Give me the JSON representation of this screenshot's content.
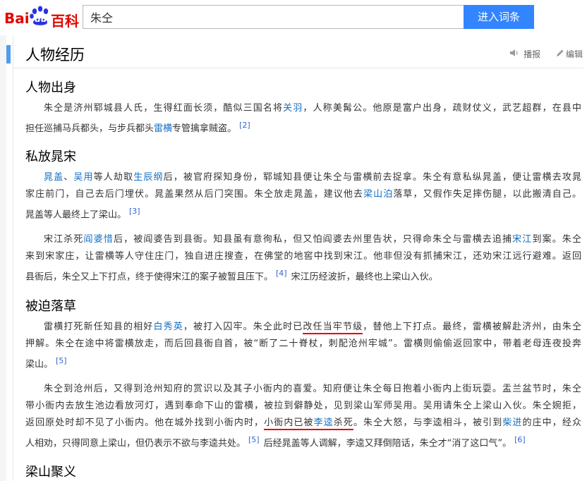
{
  "header": {
    "logo_bai": "Bai",
    "logo_du": "du",
    "logo_baike": "百科",
    "search_value": "朱仝",
    "search_button": "进入词条"
  },
  "section": {
    "title": "人物经历",
    "play_label": "播报",
    "edit_label": "编辑"
  },
  "subsections": [
    {
      "title": "人物出身"
    },
    {
      "title": "私放晁宋"
    },
    {
      "title": "被迫落草"
    },
    {
      "title": "梁山聚义"
    }
  ],
  "text": {
    "p1l1a": "朱仝是济州郓城县人氏，生得红面长须，酷似三国名将",
    "p1l1link": "关羽",
    "p1l1b": "，人称美髯公。他原是富户出身，疏财仗义，武艺超群，在县中",
    "p1l2a": "担任",
    "p1l2ul": "巡捕马兵都头，与步兵都头",
    "p1l2link": "雷横",
    "p1l2ul2": "专管擒拿贼盗",
    "p1l2b": "。",
    "p1sup": "[2]",
    "p2l1link1": "晁盖",
    "p2l1sep": "、",
    "p2l1link2": "吴用",
    "p2l1a": "等人劫取",
    "p2l1link3": "生辰纲",
    "p2l1b": "后，被官府探知身份，郓城知县便让朱仝与雷横前去捉拿。朱仝有意私纵晁盖，便让雷横去攻晁",
    "p2l2a": "家庄前门，自己去后门埋伏。晁盖果然从后门突围。朱仝放走晁盖，建议他去",
    "p2l2link": "梁山泊",
    "p2l2b": "落草，又假作失足摔伤腿，以此搬清自己。",
    "p2l3": "晁盖等人最终上了梁山。",
    "p2sup": "[3]",
    "p3l1a": "宋江杀死",
    "p3l1link": "阎婆惜",
    "p3l1b": "后，被阎婆告到县衙。知县虽有意徇私，但又怕阎婆去州里告状，只得命朱仝与雷横去追捕",
    "p3l1link2": "宋江",
    "p3l1c": "到案。朱仝",
    "p3l2": "来到宋家庄，让雷横等人守住庄门，独自进庄搜查，在佛堂的地窖中找到宋江。他非但没有抓捕宋江，还劝宋江远行避难。返回",
    "p3l3a": "县衙后，朱仝又上下打点，终于使得宋江的案子被暂且压下。",
    "p3sup": "[4]",
    "p3l3b": "宋江历经波折，最终也上梁山入伙。",
    "p4l1a": "雷横打死新任知县的相好",
    "p4l1link": "白秀英",
    "p4l1b": "，被打入囚牢。朱仝此时已",
    "p4l1ul": "改任当牢节级",
    "p4l1c": "，替他上下打点。最终，雷横被解赴济州，由朱仝",
    "p4l2": "押解。朱仝在途中将雷横放走，而后回县衙自首，被“断了二十脊杖，刺配沧州牢城”。雷横则偷偷返回家中，带着老母连夜投奔",
    "p4l3": "梁山。",
    "p4sup": "[5]",
    "p5l1": "朱仝到沧州后，又得到沧州知府的赏识以及其子小衙内的喜爱。知府便让朱仝每日抱着小衙内上街玩耍。盂兰盆节时，朱仝",
    "p5l2": "带小衙内去放生池边看放河灯，遇到奉命下山的雷横，被拉到僻静处，见到梁山军师吴用。吴用请朱仝上梁山入伙。朱仝婉拒，",
    "p5l3a": "返回原处时却不见了小衙内。他在城外找到小衙内时，",
    "p5l3ul": "小衙内已被",
    "p5l3link": "李逵",
    "p5l3ul2": "杀死",
    "p5l3b": "。朱仝大怒，与李逵相斗，被引到",
    "p5l3link2": "柴进",
    "p5l3c": "的庄中，经众",
    "p5l4a": "人相劝，只得同意上梁山，但仍表示不欲与李逵共处。",
    "p5sup": "[5]",
    "p5l4b": "后经晁盖等人调解，李逵又拜倒陪话，朱仝才“消了这口气”。",
    "p5sup2": "[6]"
  },
  "colors": {
    "accent": "#4f9cee",
    "brand_red": "#e10601",
    "link": "#136ec2",
    "button": "#3385ff",
    "annotation_red": "#e00000"
  },
  "icons": {
    "play": "speaker-icon",
    "edit": "pencil-icon"
  }
}
